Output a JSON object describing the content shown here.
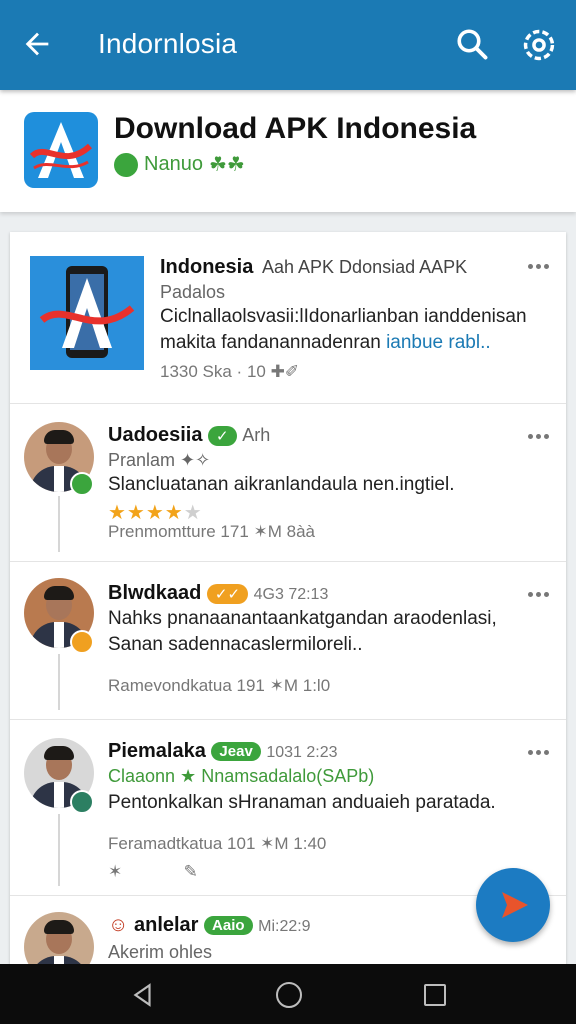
{
  "appbar": {
    "title": "Indornlosia",
    "icons": [
      "arrow-back-icon",
      "search-icon",
      "settings-icon"
    ],
    "color": "#1b7ab4"
  },
  "header": {
    "title": "Download APK Indonesia",
    "subtitle": "Nanuo",
    "subtitle_suffix": "☘☘"
  },
  "featured": {
    "name": "Indonesia",
    "tags": "Aah APK  Ddonsiad AAPK",
    "meta": "Padalos",
    "text_line1": "Ciclnallaolsvasii:lIdonarlianban  ianddenisan",
    "text_line2_a": "makita  fandanannadenran ",
    "text_line2_link": "ianbue rabl..",
    "stats": "1330 Ska  ·  10  ✚✐"
  },
  "posts": [
    {
      "name": "Uadoesiia",
      "badge_text": "",
      "extra": "Arh",
      "meta": "Pranlam  ✦✧",
      "text": "Slancluatanan aikranlandaula nen.ingtiel.",
      "rating": 4,
      "stats": "Prenmomtture   171    ✶M    8àà",
      "status_color": "#3ba53d"
    },
    {
      "name": "Blwdkaad",
      "badge_text": "✓✓",
      "extra": "4G3 72:13",
      "meta": "",
      "text": "Nahks pnanaanantaankatgandan araodenlasi, Sanan sadennacaslermiloreli..",
      "stats": "Ramevondkatua   191    ✶M    1:l0",
      "status_color": "#f0a020"
    },
    {
      "name": "Piemalaka",
      "badge_text": "Jeav",
      "extra": "1031 2:23",
      "meta": "Claaonn ★ Nnamsadalalo(SAPb)",
      "text": "Pentonkalkan sHranaman anduaieh paratada.",
      "stats": "Feramadtkatua   101    ✶M    1:40",
      "status_color": "#2c7f62"
    },
    {
      "name": "anlelar",
      "badge_text": "Aaio",
      "extra": "Mi:22:9",
      "meta": "Akerim ohles",
      "text": "",
      "stats": "",
      "status_color": "#3ba53d"
    }
  ],
  "nav": [
    "back-nav-icon",
    "home-nav-icon",
    "recents-nav-icon"
  ]
}
